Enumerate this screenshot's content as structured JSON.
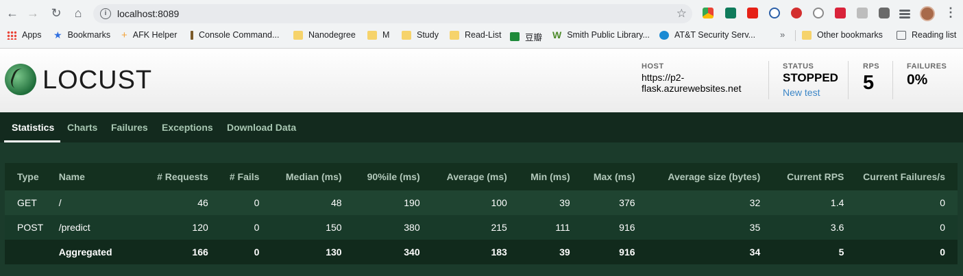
{
  "browser": {
    "url": "localhost:8089",
    "bookmarks": [
      {
        "label": "Apps",
        "icon": "apps-grid-icon"
      },
      {
        "label": "Bookmarks",
        "icon": "star-icon"
      },
      {
        "label": "AFK Helper",
        "icon": "plus-sparkle-icon"
      },
      {
        "label": "Console Command...",
        "icon": "sword-icon"
      },
      {
        "label": "Nanodegree",
        "icon": "folder-icon"
      },
      {
        "label": "M",
        "icon": "folder-icon"
      },
      {
        "label": "Study",
        "icon": "folder-icon"
      },
      {
        "label": "Read-List",
        "icon": "folder-icon"
      },
      {
        "label": "豆瓣",
        "icon": "douban-icon"
      },
      {
        "label": "Smith Public Library...",
        "icon": "w-logo-icon"
      },
      {
        "label": "AT&T Security Serv...",
        "icon": "att-globe-icon"
      }
    ],
    "other_bookmarks": "Other bookmarks",
    "reading_list": "Reading list"
  },
  "header": {
    "logo_text": "LOCUST",
    "host_label": "HOST",
    "host_value": "https://p2-flask.azurewebsites.net",
    "status_label": "STATUS",
    "status_value": "STOPPED",
    "new_test": "New test",
    "rps_label": "RPS",
    "rps_value": "5",
    "failures_label": "FAILURES",
    "failures_value": "0%"
  },
  "tabs": [
    "Statistics",
    "Charts",
    "Failures",
    "Exceptions",
    "Download Data"
  ],
  "table": {
    "columns": [
      "Type",
      "Name",
      "# Requests",
      "# Fails",
      "Median (ms)",
      "90%ile (ms)",
      "Average (ms)",
      "Min (ms)",
      "Max (ms)",
      "Average size (bytes)",
      "Current RPS",
      "Current Failures/s"
    ],
    "rows": [
      [
        "GET",
        "/",
        "46",
        "0",
        "48",
        "190",
        "100",
        "39",
        "376",
        "32",
        "1.4",
        "0"
      ],
      [
        "POST",
        "/predict",
        "120",
        "0",
        "150",
        "380",
        "215",
        "111",
        "916",
        "35",
        "3.6",
        "0"
      ],
      [
        "",
        "Aggregated",
        "166",
        "0",
        "130",
        "340",
        "183",
        "39",
        "916",
        "34",
        "5",
        "0"
      ]
    ]
  }
}
